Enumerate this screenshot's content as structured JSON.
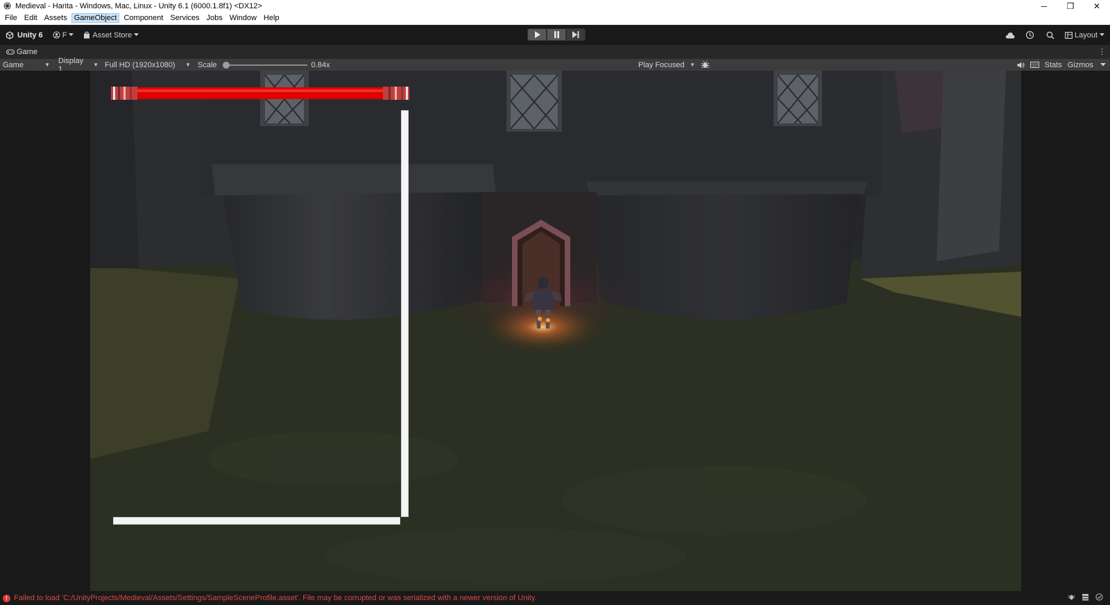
{
  "window": {
    "title": "Medieval - Harita - Windows, Mac, Linux - Unity 6.1 (6000.1.8f1) <DX12>",
    "controls": {
      "minimize": "─",
      "restore": "❐",
      "close": "✕"
    }
  },
  "menubar": {
    "items": [
      "File",
      "Edit",
      "Assets",
      "GameObject",
      "Component",
      "Services",
      "Jobs",
      "Window",
      "Help"
    ],
    "active": "GameObject"
  },
  "toolbar": {
    "unity_label": "Unity 6",
    "account_initial": "F",
    "asset_store_label": "Asset Store",
    "layout_label": "Layout",
    "icons": [
      "cloud-icon",
      "history-icon",
      "search-icon",
      "layout-icon"
    ]
  },
  "game_tab": {
    "label": "Game",
    "menu": "⋮"
  },
  "game_bar": {
    "view_select": "Game",
    "display_select": "Display 1",
    "resolution_select": "Full HD (1920x1080)",
    "scale_label": "Scale",
    "scale_value": "0.84x",
    "play_mode_select": "Play Focused",
    "stats_label": "Stats",
    "gizmos_label": "Gizmos"
  },
  "scene": {
    "health_fill": 1.0,
    "colors": {
      "health": "#e00000",
      "ui_frame": "#f4f4f4",
      "ground": "#272c1f",
      "wall": "#2b2c2f",
      "fire": "#ffb34d"
    }
  },
  "statusbar": {
    "message": "Failed to load 'C:/UnityProjects/Medieval/Assets/Settings/SampleSceneProfile.asset'. File may be corrupted or was serialized with a newer version of Unity.",
    "error_color": "#d94848"
  }
}
